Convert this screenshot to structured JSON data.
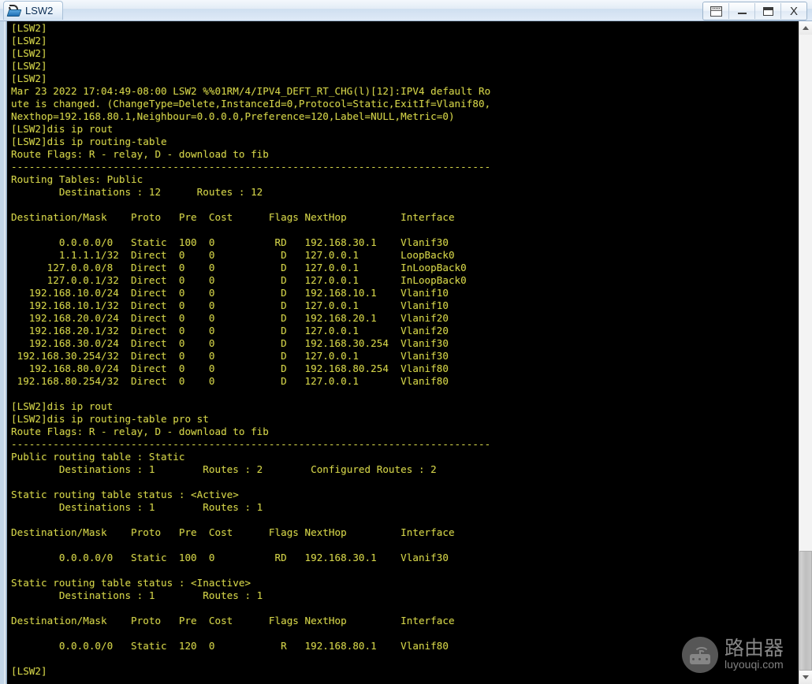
{
  "window": {
    "title": "LSW2",
    "app_icon": "network-switch-icon",
    "buttons": [
      {
        "name": "cascade-windows-button",
        "icon": "cascade-icon",
        "label": ""
      },
      {
        "name": "minimize-button",
        "icon": "minimize-icon",
        "label": ""
      },
      {
        "name": "maximize-button",
        "icon": "maximize-icon",
        "label": ""
      },
      {
        "name": "close-button",
        "icon": "close-icon",
        "label": "X"
      }
    ]
  },
  "scrollbar": {
    "up_arrow": "chevron-up-icon",
    "down_arrow": "chevron-down-icon"
  },
  "watermark": {
    "chinese": "路由器",
    "url": "luyouqi.com",
    "icon": "router-icon"
  },
  "terminal": {
    "prompt": "[LSW2]",
    "text": "[LSW2]\n[LSW2]\n[LSW2]\n[LSW2]\n[LSW2]\nMar 23 2022 17:04:49-08:00 LSW2 %%01RM/4/IPV4_DEFT_RT_CHG(l)[12]:IPV4 default Ro\nute is changed. (ChangeType=Delete,InstanceId=0,Protocol=Static,ExitIf=Vlanif80,\nNexthop=192.168.80.1,Neighbour=0.0.0.0,Preference=120,Label=NULL,Metric=0)\n[LSW2]dis ip rout\n[LSW2]dis ip routing-table\nRoute Flags: R - relay, D - download to fib\n--------------------------------------------------------------------------------\nRouting Tables: Public\n        Destinations : 12      Routes : 12\n\nDestination/Mask    Proto   Pre  Cost      Flags NextHop         Interface\n\n        0.0.0.0/0   Static  100  0          RD   192.168.30.1    Vlanif30\n        1.1.1.1/32  Direct  0    0           D   127.0.0.1       LoopBack0\n      127.0.0.0/8   Direct  0    0           D   127.0.0.1       InLoopBack0\n      127.0.0.1/32  Direct  0    0           D   127.0.0.1       InLoopBack0\n   192.168.10.0/24  Direct  0    0           D   192.168.10.1    Vlanif10\n   192.168.10.1/32  Direct  0    0           D   127.0.0.1       Vlanif10\n   192.168.20.0/24  Direct  0    0           D   192.168.20.1    Vlanif20\n   192.168.20.1/32  Direct  0    0           D   127.0.0.1       Vlanif20\n   192.168.30.0/24  Direct  0    0           D   192.168.30.254  Vlanif30\n 192.168.30.254/32  Direct  0    0           D   127.0.0.1       Vlanif30\n   192.168.80.0/24  Direct  0    0           D   192.168.80.254  Vlanif80\n 192.168.80.254/32  Direct  0    0           D   127.0.0.1       Vlanif80\n\n[LSW2]dis ip rout\n[LSW2]dis ip routing-table pro st\nRoute Flags: R - relay, D - download to fib\n--------------------------------------------------------------------------------\nPublic routing table : Static\n        Destinations : 1        Routes : 2        Configured Routes : 2\n\nStatic routing table status : <Active>\n        Destinations : 1        Routes : 1\n\nDestination/Mask    Proto   Pre  Cost      Flags NextHop         Interface\n\n        0.0.0.0/0   Static  100  0          RD   192.168.30.1    Vlanif30\n\nStatic routing table status : <Inactive>\n        Destinations : 1        Routes : 1\n\nDestination/Mask    Proto   Pre  Cost      Flags NextHop         Interface\n\n        0.0.0.0/0   Static  120  0           R   192.168.80.1    Vlanif80\n\n[LSW2]",
    "colors": {
      "background": "#000000",
      "foreground": "#d2d24a"
    },
    "commands": [
      "dis ip rout",
      "dis ip routing-table",
      "dis ip rout",
      "dis ip routing-table pro st"
    ],
    "log_message": {
      "timestamp": "Mar 23 2022 17:04:49-08:00",
      "device": "LSW2",
      "code": "%%01RM/4/IPV4_DEFT_RT_CHG(l)[12]",
      "summary": "IPV4 default Route is changed.",
      "change_type": "Delete",
      "instance_id": "0",
      "protocol": "Static",
      "exit_if": "Vlanif80",
      "nexthop": "192.168.80.1",
      "neighbour": "0.0.0.0",
      "preference": "120",
      "label": "NULL",
      "metric": "0"
    },
    "route_flags_legend": "Route Flags: R - relay, D - download to fib",
    "public_table": {
      "title": "Routing Tables: Public",
      "destinations": "12",
      "routes": "12",
      "columns": [
        "Destination/Mask",
        "Proto",
        "Pre",
        "Cost",
        "Flags",
        "NextHop",
        "Interface"
      ],
      "rows": [
        [
          "0.0.0.0/0",
          "Static",
          "100",
          "0",
          "RD",
          "192.168.30.1",
          "Vlanif30"
        ],
        [
          "1.1.1.1/32",
          "Direct",
          "0",
          "0",
          "D",
          "127.0.0.1",
          "LoopBack0"
        ],
        [
          "127.0.0.0/8",
          "Direct",
          "0",
          "0",
          "D",
          "127.0.0.1",
          "InLoopBack0"
        ],
        [
          "127.0.0.1/32",
          "Direct",
          "0",
          "0",
          "D",
          "127.0.0.1",
          "InLoopBack0"
        ],
        [
          "192.168.10.0/24",
          "Direct",
          "0",
          "0",
          "D",
          "192.168.10.1",
          "Vlanif10"
        ],
        [
          "192.168.10.1/32",
          "Direct",
          "0",
          "0",
          "D",
          "127.0.0.1",
          "Vlanif10"
        ],
        [
          "192.168.20.0/24",
          "Direct",
          "0",
          "0",
          "D",
          "192.168.20.1",
          "Vlanif20"
        ],
        [
          "192.168.20.1/32",
          "Direct",
          "0",
          "0",
          "D",
          "127.0.0.1",
          "Vlanif20"
        ],
        [
          "192.168.30.0/24",
          "Direct",
          "0",
          "0",
          "D",
          "192.168.30.254",
          "Vlanif30"
        ],
        [
          "192.168.30.254/32",
          "Direct",
          "0",
          "0",
          "D",
          "127.0.0.1",
          "Vlanif30"
        ],
        [
          "192.168.80.0/24",
          "Direct",
          "0",
          "0",
          "D",
          "192.168.80.254",
          "Vlanif80"
        ],
        [
          "192.168.80.254/32",
          "Direct",
          "0",
          "0",
          "D",
          "127.0.0.1",
          "Vlanif80"
        ]
      ]
    },
    "static_table": {
      "title": "Public routing table : Static",
      "destinations": "1",
      "routes": "2",
      "configured_routes": "2",
      "active": {
        "status": "Static routing table status : <Active>",
        "destinations": "1",
        "routes": "1",
        "rows": [
          [
            "0.0.0.0/0",
            "Static",
            "100",
            "0",
            "RD",
            "192.168.30.1",
            "Vlanif30"
          ]
        ]
      },
      "inactive": {
        "status": "Static routing table status : <Inactive>",
        "destinations": "1",
        "routes": "1",
        "rows": [
          [
            "0.0.0.0/0",
            "Static",
            "120",
            "0",
            "R",
            "192.168.80.1",
            "Vlanif80"
          ]
        ]
      }
    }
  }
}
